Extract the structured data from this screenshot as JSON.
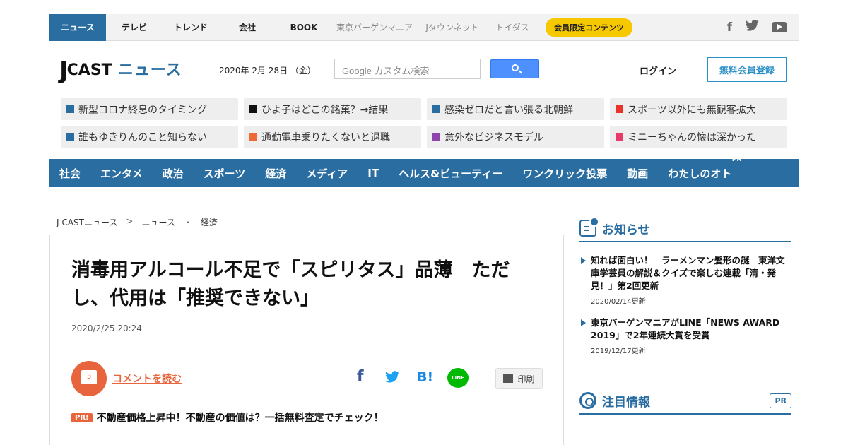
{
  "topnav": {
    "items": [
      {
        "label": "ニュース"
      },
      {
        "label": "テレビ"
      },
      {
        "label": "トレンド"
      },
      {
        "label": "会社"
      },
      {
        "label": "BOOK"
      },
      {
        "label": "東京バーゲンマニア"
      },
      {
        "label": "Jタウンネット"
      },
      {
        "label": "トイダス"
      }
    ],
    "badge": "会員限定コンテンツ",
    "social": [
      "facebook-icon",
      "twitter-icon",
      "youtube-icon"
    ]
  },
  "header": {
    "logo_j": "J",
    "logo_cast": "CAST",
    "logo_news": "ニュース",
    "date": "2020年 2月 28日 （金）",
    "search_placeholder": "Google カスタム検索",
    "login": "ログイン",
    "register": "無料会員登録"
  },
  "tags": [
    {
      "label": "新型コロナ終息のタイミング",
      "color": "#2a6da1"
    },
    {
      "label": "ひよ子はどこの銘菓？→結果",
      "color": "#111111"
    },
    {
      "label": "感染ゼロだと言い張る北朝鮮",
      "color": "#2a6da1"
    },
    {
      "label": "スポーツ以外にも無観客拡大",
      "color": "#e8342c"
    },
    {
      "label": "誰もゆきりんのこと知らない",
      "color": "#2a6da1"
    },
    {
      "label": "通勤電車乗りたくないと退職",
      "color": "#ee6a35"
    },
    {
      "label": "意外なビジネスモデル",
      "color": "#8e44ad"
    },
    {
      "label": "ミニーちゃんの懐は深かった",
      "color": "#e83b6b"
    }
  ],
  "categories": [
    {
      "label": "社会"
    },
    {
      "label": "エンタメ"
    },
    {
      "label": "政治"
    },
    {
      "label": "スポーツ"
    },
    {
      "label": "経済"
    },
    {
      "label": "メディア"
    },
    {
      "label": "IT"
    },
    {
      "label": "ヘルス&ビューティー"
    },
    {
      "label": "ワンクリック投票"
    },
    {
      "label": "動画"
    },
    {
      "label": "わたしのオト"
    }
  ],
  "category_pr": "PR",
  "breadcrumb": {
    "items": [
      "J-CASTニュース",
      "ニュース",
      "経済"
    ],
    "seps": [
      ">",
      "・"
    ]
  },
  "article": {
    "headline": "消毒用アルコール不足で「スピリタス」品薄　ただし、代用は「推奨できない」",
    "date": "2020/2/25 20:24",
    "comment_count": "3",
    "comment_link": "コメントを読む",
    "share_fb": "f",
    "share_hb": "B!",
    "share_line": "LINE",
    "print": "印刷",
    "ad_badge": "PR!",
    "ad_text": "不動産価格上昇中！不動産の価値は？一括無料査定でチェック！"
  },
  "sidebar": {
    "notice_title": "お知らせ",
    "notices": [
      {
        "title": "知れば面白い！　ラーメンマン髪形の謎　東洋文庫学芸員の解説＆クイズで楽しむ連載「清・発見！」第2回更新",
        "date": "2020/02/14更新"
      },
      {
        "title": "東京バーゲンマニアがLINE「NEWS AWARD 2019」で2年連続大賞を受賞",
        "date": "2019/12/17更新"
      }
    ],
    "featured_title": "注目情報",
    "featured_pr": "PR"
  }
}
